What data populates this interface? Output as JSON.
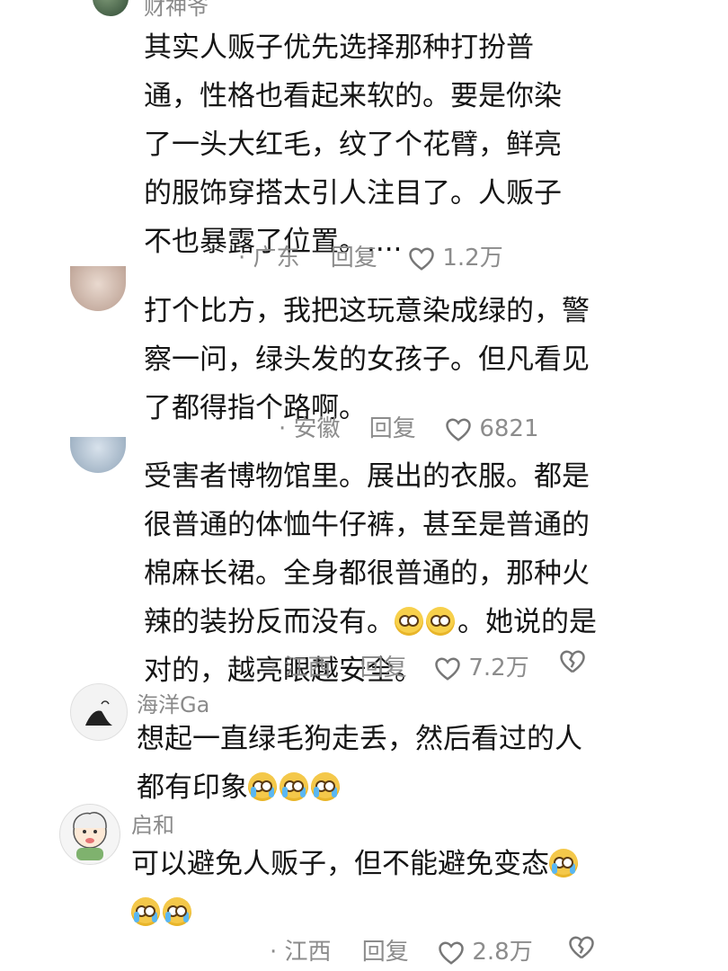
{
  "comments": [
    {
      "username": "财神爷",
      "text_lines": [
        "其实人贩子优先选择那种打扮普",
        "通，性格也看起来软的。要是你染",
        "了一头大红毛，纹了个花臂，鲜亮",
        "的服饰穿搭太引人注目了。人贩子",
        "不也暴露了位置。...."
      ],
      "location": "· 广东",
      "reply": "回复",
      "likes": "1.2万"
    },
    {
      "username": "",
      "text_lines": [
        "打个比方，我把这玩意染成绿的，警",
        "察一问，绿头发的女孩子。但凡看见",
        "了都得指个路啊。"
      ],
      "location": "· 安徽",
      "reply": "回复",
      "likes": "6821"
    },
    {
      "username": "",
      "text_lines": [
        "受害者博物馆里。展出的衣服。都是",
        "很普通的体恤牛仔裤，甚至是普通的",
        "棉麻长裙。全身都很普通的，那种火",
        "辣的装扮反而没有。",
        "。她说的是",
        "对的，越亮眼越安全。"
      ],
      "location": "· 江西",
      "reply": "回复",
      "likes": "7.2万"
    },
    {
      "username": "海洋Ga",
      "text_lines": [
        "想起一直绿毛狗走丢，然后看过的人",
        "都有印象"
      ]
    },
    {
      "username": "启和",
      "text_lines": [
        "可以避免人贩子，但不能避免变态"
      ],
      "location": "· 江西",
      "reply": "回复",
      "likes": "2.8万"
    }
  ],
  "colors": {
    "text": "#151515",
    "meta": "#8c8c8c"
  },
  "icons": [
    "heart-icon",
    "broken-heart-icon",
    "rolling-eyes-emoji",
    "crying-emoji"
  ]
}
